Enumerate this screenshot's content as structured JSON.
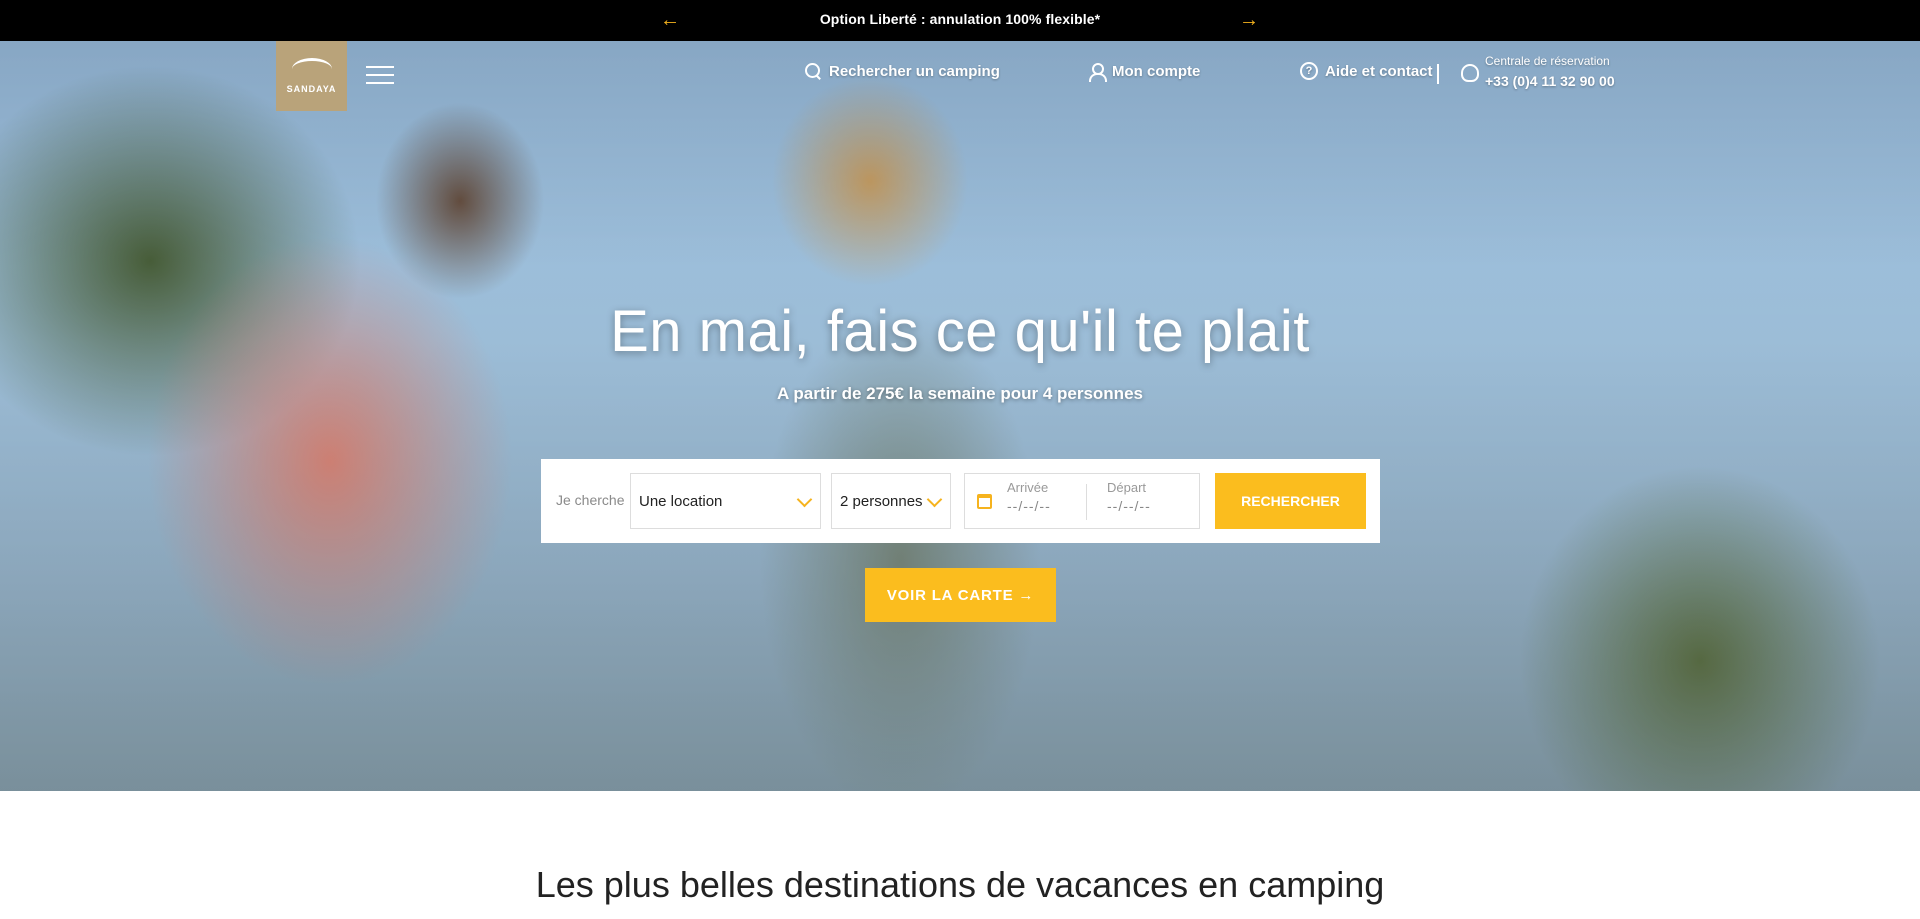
{
  "announcement": {
    "text": "Option Liberté : annulation 100% flexible*",
    "prev_icon": "arrow-left-icon",
    "next_icon": "arrow-right-icon"
  },
  "header": {
    "logo_text": "SANDAYA",
    "search_label": "Rechercher un camping",
    "account_label": "Mon compte",
    "help_label": "Aide et contact",
    "help_icon_char": "?",
    "phone_label": "Centrale de réservation",
    "phone_number": "+33 (0)4 11 32 90 00"
  },
  "hero": {
    "headline": "En mai, fais ce qu'il te plait",
    "subline": "A partir de 275€ la semaine pour 4 personnes"
  },
  "search_form": {
    "prefix": "Je cherche",
    "type_value": "Une location",
    "people_value": "2 personnes",
    "arrival_label": "Arrivée",
    "arrival_value": "--/--/--",
    "departure_label": "Départ",
    "departure_value": "--/--/--",
    "submit_label": "RECHERCHER"
  },
  "map_button": "VOIR LA CARTE →",
  "section_title": "Les plus belles destinations de vacances en camping",
  "colors": {
    "accent": "#fbbd1e",
    "logo": "#b9a37a",
    "topbar": "#000000"
  }
}
